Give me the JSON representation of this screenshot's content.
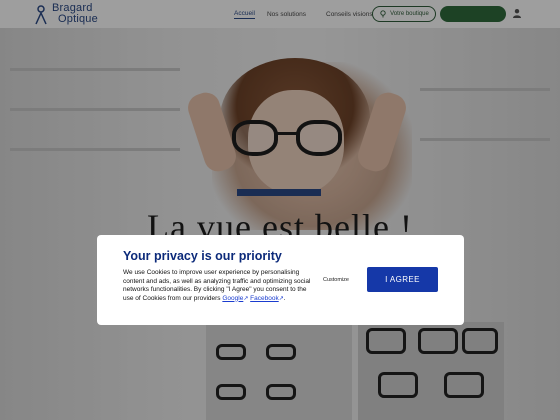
{
  "header": {
    "logo": {
      "line1": "Bragard",
      "line2": "Optique"
    },
    "nav": [
      {
        "label": "Accueil",
        "active": true
      },
      {
        "label": "Nos solutions",
        "active": false
      },
      {
        "label": "Conseils visions",
        "active": false
      }
    ],
    "store_button": {
      "label": "Votre boutique",
      "icon": "store-icon"
    },
    "appointment_button": {
      "label": ""
    },
    "user_icon": "user-icon"
  },
  "hero": {
    "title": "La vue est belle !"
  },
  "cookie_modal": {
    "title": "Your privacy is our priority",
    "body": "We use Cookies to improve user experience by personalising content and ads, as well as analyzing traffic and optimizing social networks functionalities. By clicking \"I Agree\" you consent to the use of Cookies from our providers",
    "link_google": "Google",
    "link_facebook": "Facebook",
    "separator": "",
    "end": ".",
    "customize_label": "Customize",
    "agree_label": "I AGREE"
  },
  "colors": {
    "brand_blue": "#2b4a86",
    "agree_blue": "#1538a8",
    "title_blue": "#0c2a7a",
    "green": "#2f6b3d"
  }
}
